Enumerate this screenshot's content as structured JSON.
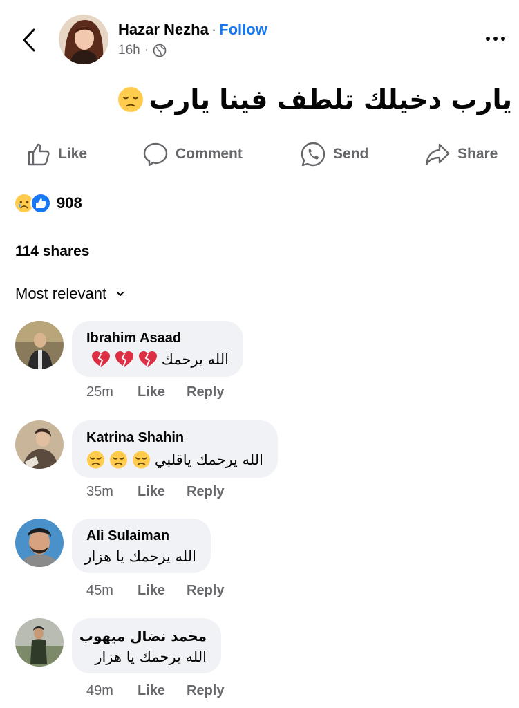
{
  "header": {
    "author": "Hazar Nezha",
    "separator": "·",
    "follow_label": "Follow",
    "time": "16h",
    "meta_separator": "·",
    "audience_icon": "globe-icon"
  },
  "post": {
    "text": "يارب دخيلك تلطف فينا يارب",
    "emoji": "pensive-face"
  },
  "actions": {
    "like": "Like",
    "comment": "Comment",
    "send": "Send",
    "share": "Share"
  },
  "reactions": {
    "icons": [
      "sad-face",
      "thumbs-up"
    ],
    "count": "908"
  },
  "shares": "114 shares",
  "sort_label": "Most relevant",
  "comments": [
    {
      "name": "Ibrahim Asaad",
      "text": "الله يرحمك",
      "emoji": "broken-heart",
      "emoji_count": 3,
      "time": "25m",
      "like": "Like",
      "reply": "Reply"
    },
    {
      "name": "Katrina Shahin",
      "text": "الله يرحمك ياقلبي",
      "emoji": "disappointed-face",
      "emoji_count": 3,
      "time": "35m",
      "like": "Like",
      "reply": "Reply"
    },
    {
      "name": "Ali Sulaiman",
      "text": "الله يرحمك يا هزار",
      "time": "45m",
      "like": "Like",
      "reply": "Reply"
    },
    {
      "name": "محمد نضال ميهوب",
      "text": "الله يرحمك يا هزار",
      "time": "49m",
      "like": "Like",
      "reply": "Reply"
    }
  ],
  "colors": {
    "accent": "#1877f2",
    "secondary_text": "#65676b",
    "bubble": "#f0f2f5"
  }
}
